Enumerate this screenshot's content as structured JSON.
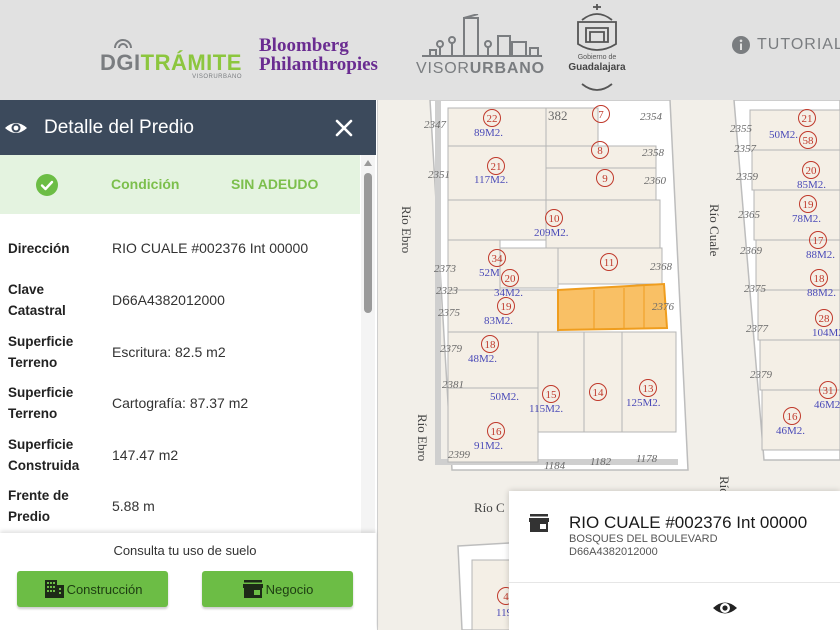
{
  "header": {
    "digitramite": {
      "prefix": "D",
      "mid": "GI",
      "accent": "TRÁMITE",
      "sub": "VISORURBANO"
    },
    "bloomberg": {
      "line1": "Bloomberg",
      "line2": "Philanthropies"
    },
    "visor": {
      "part1": "VISOR",
      "part2": "URBANO"
    },
    "guadalajara": {
      "line1": "Gobierno de",
      "line2": "Guadalajara"
    },
    "tutorial_label": "TUTORIAL"
  },
  "panel": {
    "title": "Detalle del Predio",
    "status": {
      "label": "Condición",
      "value": "SIN ADEUDO"
    },
    "fields": [
      {
        "key": "Dirección",
        "value": "RIO CUALE #002376 Int 00000"
      },
      {
        "key": "Clave Catastral",
        "value": "D66A4382012000"
      },
      {
        "key": "Superficie Terreno",
        "value": "Escritura: 82.5 m2"
      },
      {
        "key": "Superficie Terreno",
        "value": "Cartografía: 87.37 m2"
      },
      {
        "key": "Superficie Construida",
        "value": "147.47 m2"
      },
      {
        "key": "Frente de Predio",
        "value": "5.88 m"
      }
    ],
    "footer": {
      "consult": "Consulta tu uso de suelo",
      "btn_construccion": "Construcción",
      "btn_negocio": "Negocio"
    }
  },
  "popup": {
    "address": "RIO CUALE #002376 Int 00000",
    "colonia": "BOSQUES DEL BOULEVARD",
    "clave": "D66A4382012000"
  },
  "map": {
    "streets": [
      "Río Ebro",
      "Río Cuale",
      "Río Ebro",
      "Río C",
      "Río"
    ],
    "lots": [
      {
        "n": "22",
        "area": "89M2."
      },
      {
        "n": "7"
      },
      {
        "n": "8"
      },
      {
        "n": "9"
      },
      {
        "n": "21",
        "area": "117M2."
      },
      {
        "n": "10",
        "area": "209M2."
      },
      {
        "n": "34",
        "area": "52M"
      },
      {
        "n": "20",
        "area": "34M2."
      },
      {
        "n": "11"
      },
      {
        "n": "19",
        "area": "83M2."
      },
      {
        "n": "18",
        "area": "48M2."
      },
      {
        "n": "15",
        "area": "115M2."
      },
      {
        "n": "14"
      },
      {
        "n": "13",
        "area": "125M2."
      },
      {
        "n": "16",
        "area": "91M2."
      },
      {
        "area": "50M2."
      },
      {
        "n": "21",
        "area": "50M2."
      },
      {
        "n": "58"
      },
      {
        "n": "20",
        "area": "85M2."
      },
      {
        "n": "19",
        "area": "78M2."
      },
      {
        "n": "17",
        "area": "88M2."
      },
      {
        "n": "18",
        "area": "88M2."
      },
      {
        "n": "28",
        "area": "104M2"
      },
      {
        "n": "31",
        "area": "46M2"
      },
      {
        "n": "16",
        "area": "46M2."
      },
      {
        "n": "4",
        "area": "119"
      }
    ],
    "numbers": [
      "2347",
      "382",
      "2354",
      "2351",
      "2358",
      "2360",
      "2373",
      "2323",
      "2375",
      "2368",
      "2376",
      "2379",
      "2381",
      "2399",
      "1184",
      "1182",
      "1178",
      "2355",
      "2357",
      "2359",
      "2365",
      "2369",
      "2375",
      "2377",
      "2379"
    ],
    "colors": {
      "selected_fill": "#f8b54a",
      "selected_stroke": "#ef9d1e",
      "lot_num": "#c0392b",
      "area": "#4a4ab8",
      "block": "#ffffff"
    }
  }
}
